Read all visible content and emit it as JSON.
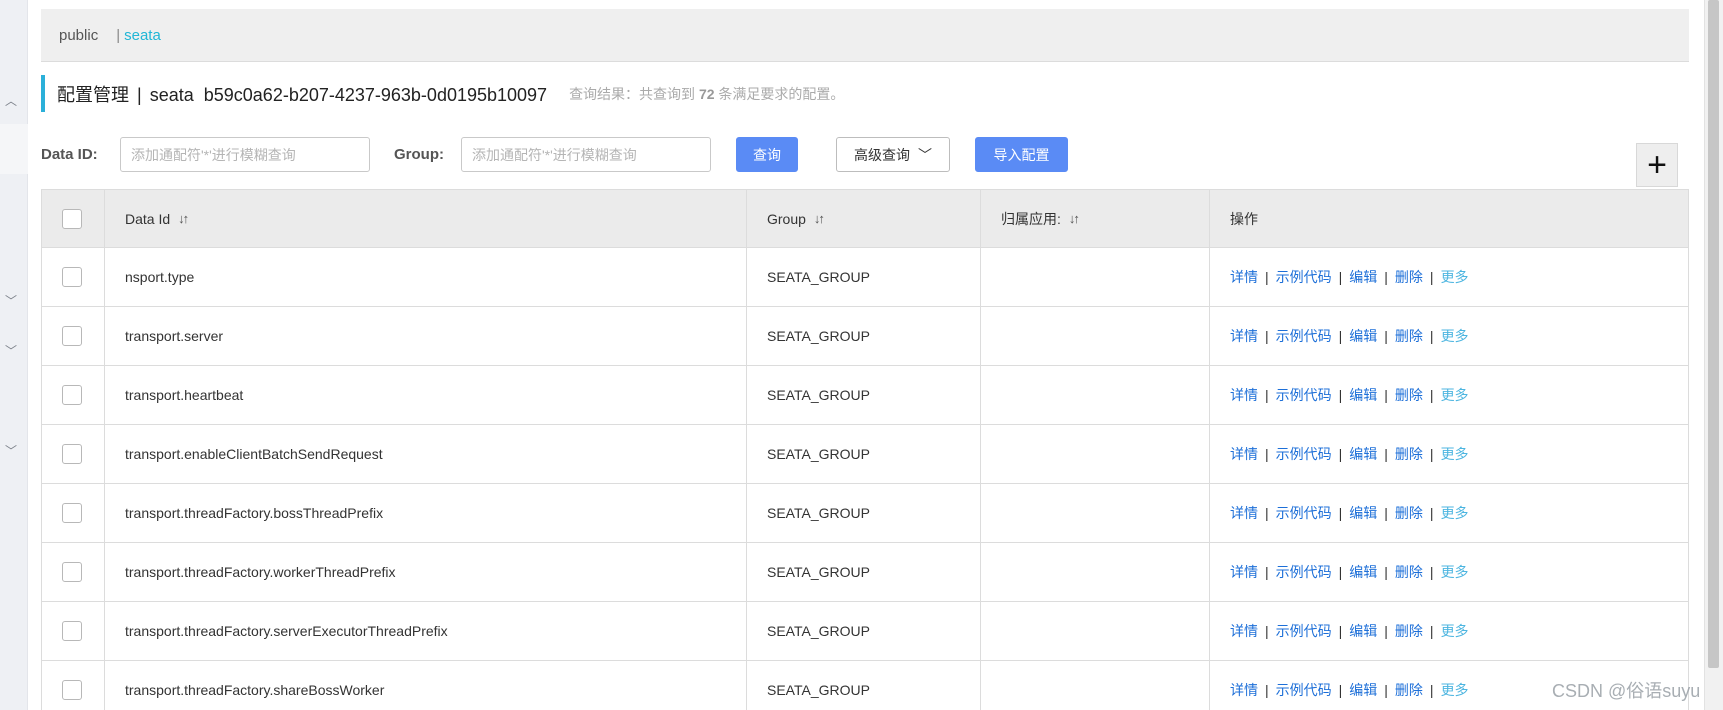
{
  "namespaces": [
    "public",
    "seata"
  ],
  "namespace_separator": "|",
  "title": {
    "main": "配置管理",
    "pipe": "|",
    "namespace": "seata",
    "namespace_id": "b59c0a62-b207-4237-963b-0d0195b10097",
    "result_prefix": "查询结果：共查询到",
    "result_count": "72",
    "result_suffix": "条满足要求的配置。"
  },
  "filters": {
    "data_id_label": "Data ID:",
    "data_id_placeholder": "添加通配符'*'进行模糊查询",
    "group_label": "Group:",
    "group_placeholder": "添加通配符'*'进行模糊查询",
    "query_button": "查询",
    "advanced_button": "高级查询",
    "import_button": "导入配置"
  },
  "add_button": "+",
  "table": {
    "columns": [
      "Data Id",
      "Group",
      "归属应用:",
      "操作"
    ],
    "sort_icon": "↓↑",
    "actions": [
      "详情",
      "示例代码",
      "编辑",
      "删除",
      "更多"
    ],
    "action_separator": "|",
    "rows": [
      {
        "data_id": "nsport.type",
        "group": "SEATA_GROUP",
        "app": ""
      },
      {
        "data_id": "transport.server",
        "group": "SEATA_GROUP",
        "app": ""
      },
      {
        "data_id": "transport.heartbeat",
        "group": "SEATA_GROUP",
        "app": ""
      },
      {
        "data_id": "transport.enableClientBatchSendRequest",
        "group": "SEATA_GROUP",
        "app": ""
      },
      {
        "data_id": "transport.threadFactory.bossThreadPrefix",
        "group": "SEATA_GROUP",
        "app": ""
      },
      {
        "data_id": "transport.threadFactory.workerThreadPrefix",
        "group": "SEATA_GROUP",
        "app": ""
      },
      {
        "data_id": "transport.threadFactory.serverExecutorThreadPrefix",
        "group": "SEATA_GROUP",
        "app": ""
      },
      {
        "data_id": "transport.threadFactory.shareBossWorker",
        "group": "SEATA_GROUP",
        "app": ""
      }
    ]
  },
  "watermark": "CSDN @俗语suyu",
  "colors": {
    "accent": "#2bb0d9",
    "primary_button": "#5a8bf5",
    "link": "#1d6fd8",
    "link_more": "#4cb5e0"
  }
}
